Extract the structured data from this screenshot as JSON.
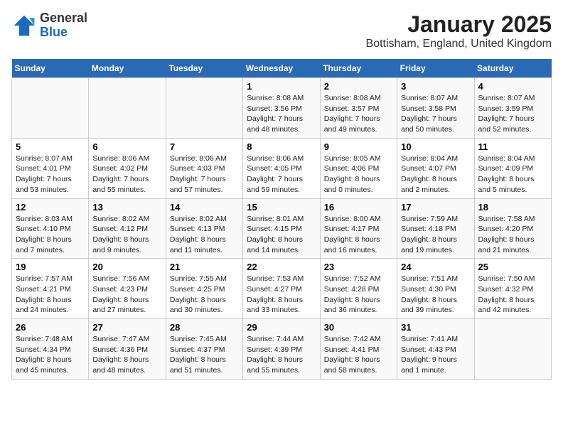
{
  "header": {
    "logo_general": "General",
    "logo_blue": "Blue",
    "title": "January 2025",
    "subtitle": "Bottisham, England, United Kingdom"
  },
  "days_of_week": [
    "Sunday",
    "Monday",
    "Tuesday",
    "Wednesday",
    "Thursday",
    "Friday",
    "Saturday"
  ],
  "weeks": [
    [
      {
        "num": "",
        "info": ""
      },
      {
        "num": "",
        "info": ""
      },
      {
        "num": "",
        "info": ""
      },
      {
        "num": "1",
        "info": "Sunrise: 8:08 AM\nSunset: 3:56 PM\nDaylight: 7 hours\nand 48 minutes."
      },
      {
        "num": "2",
        "info": "Sunrise: 8:08 AM\nSunset: 3:57 PM\nDaylight: 7 hours\nand 49 minutes."
      },
      {
        "num": "3",
        "info": "Sunrise: 8:07 AM\nSunset: 3:58 PM\nDaylight: 7 hours\nand 50 minutes."
      },
      {
        "num": "4",
        "info": "Sunrise: 8:07 AM\nSunset: 3:59 PM\nDaylight: 7 hours\nand 52 minutes."
      }
    ],
    [
      {
        "num": "5",
        "info": "Sunrise: 8:07 AM\nSunset: 4:01 PM\nDaylight: 7 hours\nand 53 minutes."
      },
      {
        "num": "6",
        "info": "Sunrise: 8:06 AM\nSunset: 4:02 PM\nDaylight: 7 hours\nand 55 minutes."
      },
      {
        "num": "7",
        "info": "Sunrise: 8:06 AM\nSunset: 4:03 PM\nDaylight: 7 hours\nand 57 minutes."
      },
      {
        "num": "8",
        "info": "Sunrise: 8:06 AM\nSunset: 4:05 PM\nDaylight: 7 hours\nand 59 minutes."
      },
      {
        "num": "9",
        "info": "Sunrise: 8:05 AM\nSunset: 4:06 PM\nDaylight: 8 hours\nand 0 minutes."
      },
      {
        "num": "10",
        "info": "Sunrise: 8:04 AM\nSunset: 4:07 PM\nDaylight: 8 hours\nand 2 minutes."
      },
      {
        "num": "11",
        "info": "Sunrise: 8:04 AM\nSunset: 4:09 PM\nDaylight: 8 hours\nand 5 minutes."
      }
    ],
    [
      {
        "num": "12",
        "info": "Sunrise: 8:03 AM\nSunset: 4:10 PM\nDaylight: 8 hours\nand 7 minutes."
      },
      {
        "num": "13",
        "info": "Sunrise: 8:02 AM\nSunset: 4:12 PM\nDaylight: 8 hours\nand 9 minutes."
      },
      {
        "num": "14",
        "info": "Sunrise: 8:02 AM\nSunset: 4:13 PM\nDaylight: 8 hours\nand 11 minutes."
      },
      {
        "num": "15",
        "info": "Sunrise: 8:01 AM\nSunset: 4:15 PM\nDaylight: 8 hours\nand 14 minutes."
      },
      {
        "num": "16",
        "info": "Sunrise: 8:00 AM\nSunset: 4:17 PM\nDaylight: 8 hours\nand 16 minutes."
      },
      {
        "num": "17",
        "info": "Sunrise: 7:59 AM\nSunset: 4:18 PM\nDaylight: 8 hours\nand 19 minutes."
      },
      {
        "num": "18",
        "info": "Sunrise: 7:58 AM\nSunset: 4:20 PM\nDaylight: 8 hours\nand 21 minutes."
      }
    ],
    [
      {
        "num": "19",
        "info": "Sunrise: 7:57 AM\nSunset: 4:21 PM\nDaylight: 8 hours\nand 24 minutes."
      },
      {
        "num": "20",
        "info": "Sunrise: 7:56 AM\nSunset: 4:23 PM\nDaylight: 8 hours\nand 27 minutes."
      },
      {
        "num": "21",
        "info": "Sunrise: 7:55 AM\nSunset: 4:25 PM\nDaylight: 8 hours\nand 30 minutes."
      },
      {
        "num": "22",
        "info": "Sunrise: 7:53 AM\nSunset: 4:27 PM\nDaylight: 8 hours\nand 33 minutes."
      },
      {
        "num": "23",
        "info": "Sunrise: 7:52 AM\nSunset: 4:28 PM\nDaylight: 8 hours\nand 36 minutes."
      },
      {
        "num": "24",
        "info": "Sunrise: 7:51 AM\nSunset: 4:30 PM\nDaylight: 8 hours\nand 39 minutes."
      },
      {
        "num": "25",
        "info": "Sunrise: 7:50 AM\nSunset: 4:32 PM\nDaylight: 8 hours\nand 42 minutes."
      }
    ],
    [
      {
        "num": "26",
        "info": "Sunrise: 7:48 AM\nSunset: 4:34 PM\nDaylight: 8 hours\nand 45 minutes."
      },
      {
        "num": "27",
        "info": "Sunrise: 7:47 AM\nSunset: 4:36 PM\nDaylight: 8 hours\nand 48 minutes."
      },
      {
        "num": "28",
        "info": "Sunrise: 7:45 AM\nSunset: 4:37 PM\nDaylight: 8 hours\nand 51 minutes."
      },
      {
        "num": "29",
        "info": "Sunrise: 7:44 AM\nSunset: 4:39 PM\nDaylight: 8 hours\nand 55 minutes."
      },
      {
        "num": "30",
        "info": "Sunrise: 7:42 AM\nSunset: 4:41 PM\nDaylight: 8 hours\nand 58 minutes."
      },
      {
        "num": "31",
        "info": "Sunrise: 7:41 AM\nSunset: 4:43 PM\nDaylight: 9 hours\nand 1 minute."
      },
      {
        "num": "",
        "info": ""
      }
    ]
  ]
}
